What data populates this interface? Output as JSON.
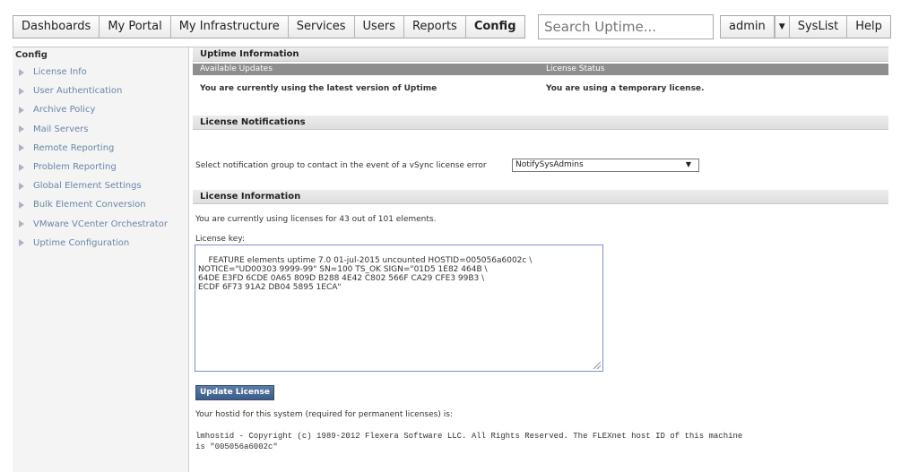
{
  "nav": {
    "tabs": [
      "Dashboards",
      "My Portal",
      "My Infrastructure",
      "Services",
      "Users",
      "Reports",
      "Config"
    ],
    "active_tab": "Config",
    "search_placeholder": "Search Uptime...",
    "user": "admin",
    "syslist": "SysList",
    "help": "Help"
  },
  "sidebar": {
    "title": "Config",
    "items": [
      "License Info",
      "User Authentication",
      "Archive Policy",
      "Mail Servers",
      "Remote Reporting",
      "Problem Reporting",
      "Global Element Settings",
      "Bulk Element Conversion",
      "VMware VCenter Orchestrator",
      "Uptime Configuration"
    ]
  },
  "uptime_info": {
    "header": "Uptime Information",
    "col_updates": "Available Updates",
    "col_license": "License Status",
    "updates_value": "You are currently using the latest version of Uptime",
    "license_value": "You are using a temporary license."
  },
  "notifications": {
    "header": "License Notifications",
    "label": "Select notification group to contact in the event of a vSync license error",
    "selected_group": "NotifySysAdmins"
  },
  "license_info": {
    "header": "License Information",
    "usage_text": "You are currently using licenses for 43 out of 101 elements.",
    "key_label": "License key:",
    "key_value": "FEATURE elements uptime 7.0 01-jul-2015 uncounted HOSTID=005056a6002c \\\nNOTICE=\"UD00303 9999-99\" SN=100 TS_OK SIGN=\"01D5 1E82 464B \\\n64DE E3FD 6CDE 0A65 809D B288 4E42 C802 566F CA29 CFE3 99B3 \\\nECDF 6F73 91A2 DB04 5895 1ECA\"",
    "update_button": "Update License",
    "hostid_label": "Your hostid for this system (required for permanent licenses) is:",
    "hostid_line1": "lmhostid - Copyright (c) 1989-2012 Flexera Software LLC. All Rights Reserved. The FLEXnet host ID of this machine",
    "hostid_line2": "is \"005056a6002c\""
  }
}
